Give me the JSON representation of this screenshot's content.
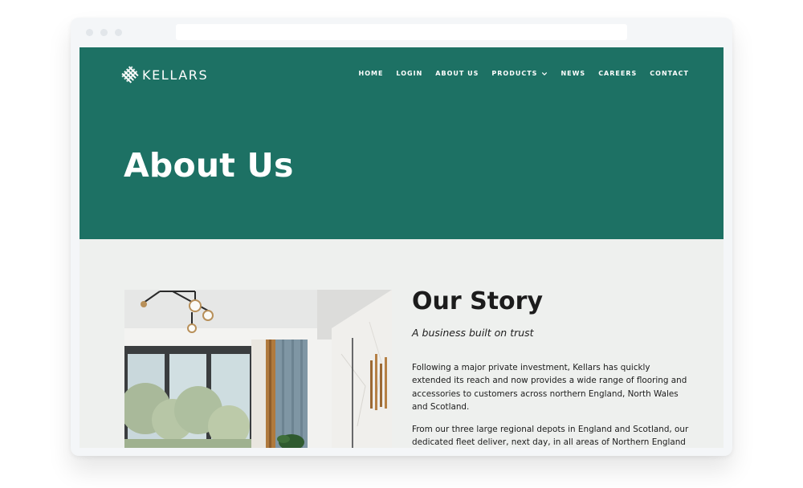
{
  "site": {
    "logo_text": "KELLARS",
    "brand_color": "#1d7164"
  },
  "nav": {
    "items": [
      {
        "label": "HOME",
        "name": "nav-home"
      },
      {
        "label": "LOGIN",
        "name": "nav-login"
      },
      {
        "label": "ABOUT US",
        "name": "nav-about-us"
      },
      {
        "label": "PRODUCTS",
        "name": "nav-products",
        "has_dropdown": true
      },
      {
        "label": "NEWS",
        "name": "nav-news"
      },
      {
        "label": "CAREERS",
        "name": "nav-careers"
      },
      {
        "label": "CONTACT",
        "name": "nav-contact"
      }
    ]
  },
  "hero": {
    "title": "About Us"
  },
  "story": {
    "heading": "Our Story",
    "tagline": "A business built on trust",
    "paragraphs": [
      "Following a major private investment, Kellars has quickly extended its reach and now provides a wide range of flooring and accessories to customers across northern England, North Wales and Scotland.",
      "From our three large regional depots in England and Scotland, our dedicated fleet deliver, next day, in all areas of Northern England"
    ]
  },
  "icons": {
    "logo": "woven-grid-logo-icon",
    "dropdown": "chevron-down-icon"
  }
}
